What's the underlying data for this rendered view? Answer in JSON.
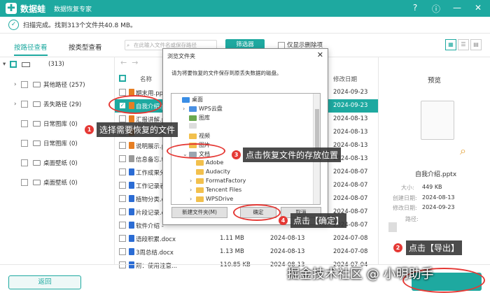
{
  "app": {
    "name": "数据蛙",
    "subtitle": "数据恢复专家"
  },
  "window_controls": [
    {
      "icon": "help-icon",
      "glyph": "?"
    },
    {
      "icon": "info-icon",
      "glyph": "ⓘ"
    },
    {
      "icon": "minimize-icon",
      "glyph": "—"
    },
    {
      "icon": "close-icon",
      "glyph": "✕"
    }
  ],
  "status": {
    "text": "扫描完成。找到313个文件共40.8 MB。"
  },
  "tabs": [
    {
      "label": "按路径查看"
    },
    {
      "label": "按类型查看"
    }
  ],
  "search": {
    "placeholder": "在此输入文件名或保存路径"
  },
  "filter_button": "筛选器",
  "only_deleted": "仅显示删除项",
  "tree": {
    "root_count": "(313)",
    "items": [
      {
        "label": "其他路径 (257)"
      },
      {
        "label": "丢失路径 (29)"
      },
      {
        "label": "日常图库 (0)"
      },
      {
        "label": "日常图库 (0)"
      },
      {
        "label": "桌面壁纸 (0)"
      },
      {
        "label": "桌面壁纸 (0)"
      }
    ]
  },
  "file_table": {
    "headers": {
      "name": "名称",
      "modified": "修改日期"
    },
    "rows": [
      {
        "name": "期末用.ppt",
        "size": "",
        "created": "",
        "modified": "2024-09-23",
        "checked": false,
        "color": "#e67e22"
      },
      {
        "name": "自我介绍.p",
        "size": "",
        "created": "",
        "modified": "2024-09-23",
        "checked": true,
        "color": "#e67e22"
      },
      {
        "name": "汇报讲解.p",
        "size": "",
        "created": "",
        "modified": "2024-08-13",
        "checked": false,
        "color": "#e67e22"
      },
      {
        "name": "",
        "size": "",
        "created": "",
        "modified": "2024-08-13",
        "checked": false,
        "color": "#e67e22"
      },
      {
        "name": "说明展示.p",
        "size": "",
        "created": "",
        "modified": "2024-08-13",
        "checked": false,
        "color": "#e67e22"
      },
      {
        "name": "信息备忘.t",
        "size": "",
        "created": "",
        "modified": "2024-08-13",
        "checked": false,
        "color": "#999999"
      },
      {
        "name": "工作成果分",
        "size": "",
        "created": "",
        "modified": "2024-08-07",
        "checked": false,
        "color": "#2b6cd4"
      },
      {
        "name": "工作记录表",
        "size": "",
        "created": "",
        "modified": "2024-08-07",
        "checked": false,
        "color": "#2b6cd4"
      },
      {
        "name": "植物分类.d",
        "size": "",
        "created": "",
        "modified": "2024-08-07",
        "checked": false,
        "color": "#2b6cd4"
      },
      {
        "name": "片段记录.d",
        "size": "",
        "created": "",
        "modified": "2024-08-07",
        "checked": false,
        "color": "#2b6cd4"
      },
      {
        "name": "软件介绍 -",
        "size": "",
        "created": "",
        "modified": "2024-08-07",
        "checked": false,
        "color": "#2b6cd4"
      },
      {
        "name": "语段积累.docx",
        "size": "1.11 MB",
        "created": "2024-08-13",
        "modified": "2024-07-08",
        "checked": false,
        "color": "#2b6cd4"
      },
      {
        "name": "3周总结.docx",
        "size": "1.13 MB",
        "created": "2024-08-13",
        "modified": "2024-07-08",
        "checked": false,
        "color": "#2b6cd4"
      },
      {
        "name": "附：使用注意...",
        "size": "110.85 KB",
        "created": "2024-08-13",
        "modified": "2024-07-04",
        "checked": false,
        "color": "#2b6cd4"
      }
    ]
  },
  "preview": {
    "title": "预览",
    "filename": "自我介绍.pptx",
    "size_label": "大小:",
    "size": "449 KB",
    "created_label": "创建日期:",
    "created": "2024-08-13",
    "modified_label": "修改日期:",
    "modified": "2024-09-23",
    "path_label": "路径:"
  },
  "bottom": {
    "back": "返回"
  },
  "dialog": {
    "title": "浏览文件夹",
    "info": "请为将要恢复的文件保存到原丢失数据的磁盘。",
    "tree": [
      {
        "label": "桌面",
        "indent": 0,
        "caret": "",
        "type": "desktop"
      },
      {
        "label": "WPS云盘",
        "indent": 1,
        "caret": "›",
        "type": "cloud"
      },
      {
        "label": "图库",
        "indent": 1,
        "caret": "",
        "type": "pics"
      },
      {
        "label": "",
        "indent": 1,
        "caret": "",
        "type": "user"
      },
      {
        "label": "视频",
        "indent": 1,
        "caret": "",
        "type": "folder"
      },
      {
        "label": "图片",
        "indent": 1,
        "caret": "",
        "type": "folder"
      },
      {
        "label": "文档",
        "indent": 1,
        "caret": "⌄",
        "type": "docs"
      },
      {
        "label": "Adobe",
        "indent": 2,
        "caret": "",
        "type": "folder"
      },
      {
        "label": "Audacity",
        "indent": 2,
        "caret": "",
        "type": "folder"
      },
      {
        "label": "FormatFactory",
        "indent": 2,
        "caret": "›",
        "type": "folder"
      },
      {
        "label": "Tencent Files",
        "indent": 2,
        "caret": "›",
        "type": "folder"
      },
      {
        "label": "WPSDrive",
        "indent": 2,
        "caret": "›",
        "type": "folder"
      }
    ],
    "new_folder": "新建文件夹(M)",
    "ok": "确定",
    "cancel": "取消"
  },
  "annotations": [
    {
      "num": "1",
      "text": "选择需要恢复的文件"
    },
    {
      "num": "3",
      "text": "点击恢复文件的存放位置"
    },
    {
      "num": "4",
      "text": "点击【确定】"
    },
    {
      "num": "2",
      "text": "点击【导出】"
    }
  ],
  "watermark": "掘金技术社区 @ 小明助手",
  "colors": {
    "accent": "#1ea9a0",
    "annotation": "#e53935"
  }
}
